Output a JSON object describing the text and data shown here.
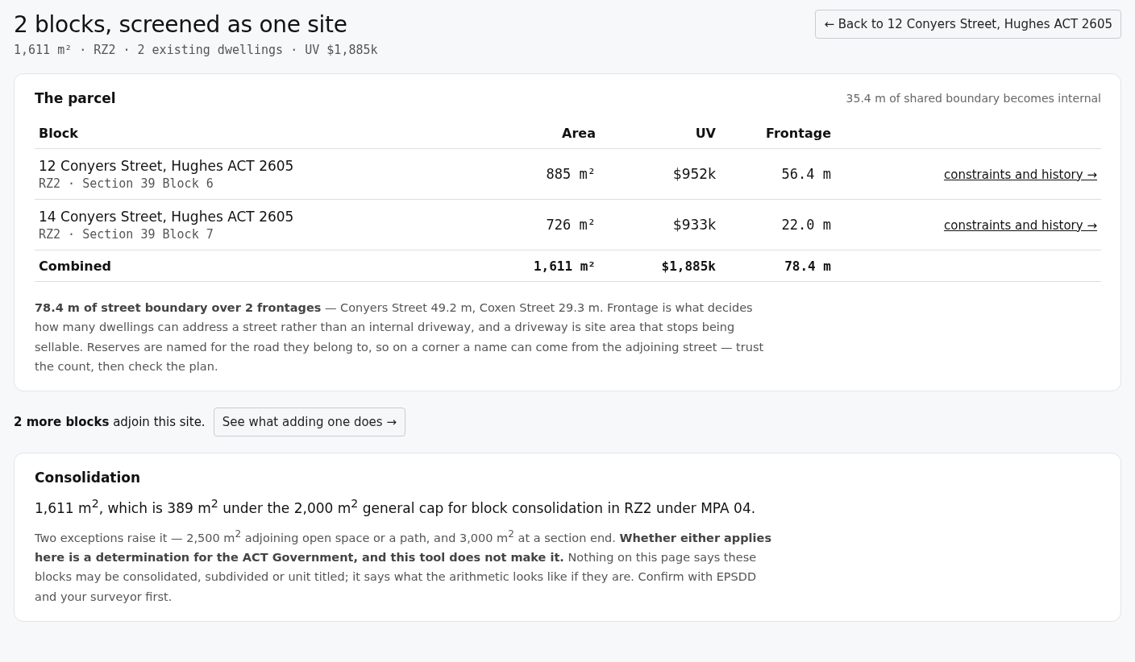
{
  "header": {
    "title": "2 blocks, screened as one site",
    "summary": "1,611 m² · RZ2 · 2 existing dwellings · UV $1,885k",
    "back_button": "← Back to 12 Conyers Street, Hughes ACT 2605"
  },
  "parcel": {
    "title": "The parcel",
    "note": "35.4 m of shared boundary becomes internal",
    "table": {
      "columns": [
        "Block",
        "Area",
        "UV",
        "Frontage"
      ],
      "rows": [
        {
          "address": "12 Conyers Street, Hughes ACT 2605",
          "detail": "RZ2 · Section 39 Block 6",
          "area": "885 m²",
          "uv": "$952k",
          "frontage": "56.4 m",
          "link": "constraints and history →"
        },
        {
          "address": "14 Conyers Street, Hughes ACT 2605",
          "detail": "RZ2 · Section 39 Block 7",
          "area": "726 m²",
          "uv": "$933k",
          "frontage": "22.0 m",
          "link": "constraints and history →"
        }
      ],
      "total": {
        "label": "Combined",
        "area": "1,611 m²",
        "uv": "$1,885k",
        "frontage": "78.4 m"
      }
    },
    "paragraph": "**78.4 m of street boundary over 2 frontages** — Conyers Street 49.2 m, Coxen Street 29.3 m. Frontage is what decides how many dwellings can address a street rather than an internal driveway, and a driveway is site area that stops being sellable. Reserves are named for the road they belong to, so on a corner a name can come from the adjoining street — trust the count, then check the plan."
  },
  "adjoin": {
    "text": "**2 more blocks** adjoin this site.",
    "button": "See what adding one does →"
  },
  "consolidation": {
    "title": "Consolidation",
    "lead": "1,611 m$^{2}$, which is 389 m$^{2}$ under the 2,000 m$^{2}$ general cap for block consolidation in RZ2 under MPA 04.",
    "paragraph": "Two exceptions raise it — 2,500 m$^{2}$ adjoining open space or a path, and 3,000 m$^{2}$ at a section end. **Whether either applies here is a determination for the ACT Government, and this tool does not make it.** Nothing on this page says these blocks may be consolidated, subdivided or unit titled; it says what the arithmetic looks like if they are. Confirm with EPSDD and your surveyor first."
  }
}
